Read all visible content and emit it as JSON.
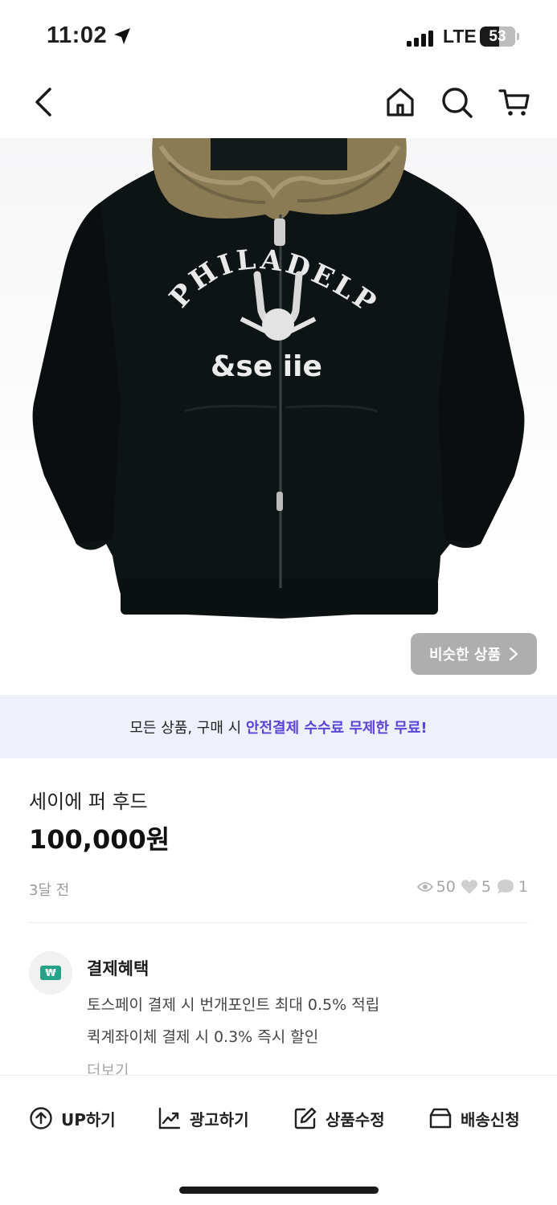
{
  "status_bar": {
    "time": "11:02",
    "network": "LTE",
    "battery": "53"
  },
  "nav": {
    "back": "back-chevron-icon",
    "home": "home-icon",
    "search": "search-icon",
    "cart": "cart-icon"
  },
  "hero": {
    "graphic_text_top": "PHILADELPHIA",
    "graphic_text_bottom": "&se iie",
    "similar_label": "비슷한 상품"
  },
  "promo": {
    "text_plain": "모든 상품, 구매 시 ",
    "text_highlight": "안전결제 수수료 무제한 무료!"
  },
  "product": {
    "title": "세이에 퍼 후드",
    "price": "100,000원",
    "posted": "3달 전",
    "views": "50",
    "likes": "5",
    "chats": "1"
  },
  "benefit": {
    "title": "결제혜택",
    "lines": [
      "토스페이 결제 시 번개포인트 최대 0.5% 적립",
      "퀵계좌이체 결제 시 0.3% 즉시 할인"
    ],
    "more": "더보기"
  },
  "actions": [
    {
      "label": "UP하기",
      "icon": "arrow-up-circle-icon"
    },
    {
      "label": "광고하기",
      "icon": "trend-chart-icon"
    },
    {
      "label": "상품수정",
      "icon": "edit-icon"
    },
    {
      "label": "배송신청",
      "icon": "box-icon"
    }
  ],
  "colors": {
    "accent": "#5b45d6",
    "promo_bg": "#eef0fb",
    "benefit_green": "#25a388"
  }
}
